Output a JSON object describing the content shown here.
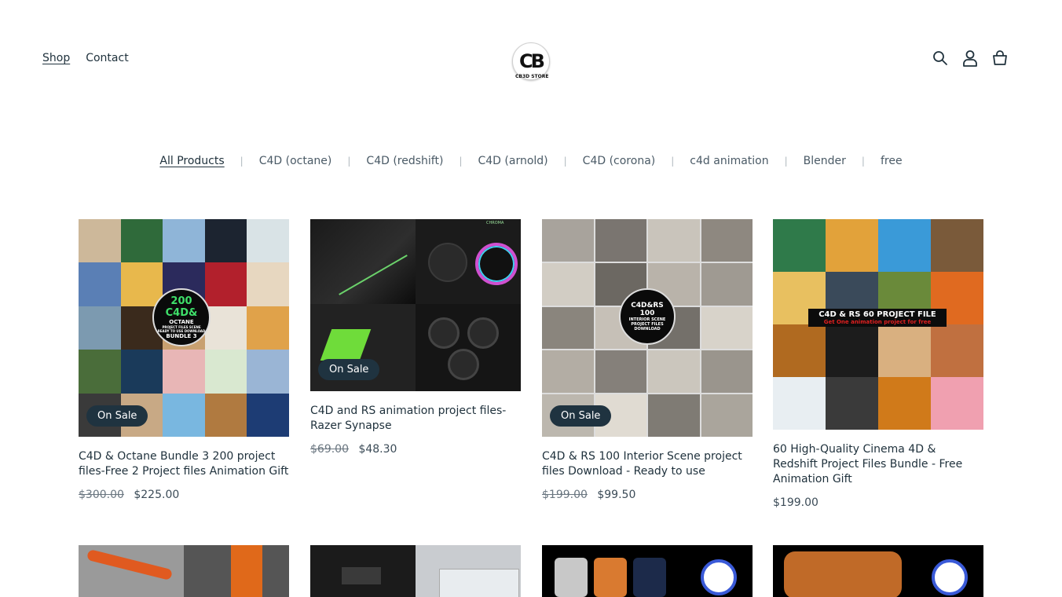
{
  "header": {
    "nav": [
      {
        "label": "Shop",
        "active": true
      },
      {
        "label": "Contact",
        "active": false
      }
    ],
    "logo": {
      "mark": "CB",
      "tagline": "CB3D STORE"
    },
    "icons": [
      "search-icon",
      "account-icon",
      "cart-icon"
    ]
  },
  "filters": [
    {
      "label": "All Products",
      "active": true
    },
    {
      "label": "C4D (octane)"
    },
    {
      "label": "C4D (redshift)"
    },
    {
      "label": "C4D (arnold)"
    },
    {
      "label": "C4D (corona)"
    },
    {
      "label": "c4d animation"
    },
    {
      "label": "Blender"
    },
    {
      "label": "free"
    }
  ],
  "products": [
    {
      "badge": "On Sale",
      "image_text": [
        "200 C4D&",
        "OCTANE",
        "PROJECT FILES SCENE",
        "READY TO USE DOWNLOAD",
        "BUNDLE 3"
      ],
      "title": "C4D & Octane Bundle 3 200 project files-Free 2 Project files Animation Gift",
      "old_price": "$300.00",
      "price": "$225.00"
    },
    {
      "badge": "On Sale",
      "image_text": [
        "CHROMA"
      ],
      "title": "C4D and RS animation project files-Razer Synapse",
      "old_price": "$69.00",
      "price": "$48.30"
    },
    {
      "badge": "On Sale",
      "image_text": [
        "C4D&RS",
        "100",
        "INTERIOR SCENE",
        "PROJECT FILES",
        "DOWNLOAD"
      ],
      "title": "C4D & RS 100 Interior Scene project files Download - Ready to use",
      "old_price": "$199.00",
      "price": "$99.50"
    },
    {
      "badge": "",
      "image_text": [
        "C4D & RS 60 PROJECT FILE",
        "Get One animation project for free"
      ],
      "title": "60 High-Quality Cinema 4D & Redshift Project Files Bundle - Free Animation Gift",
      "old_price": "",
      "price": "$199.00"
    }
  ],
  "colors": {
    "text": "#20323d",
    "badge_bg": "#1f3340",
    "accent_red": "#e02020"
  }
}
